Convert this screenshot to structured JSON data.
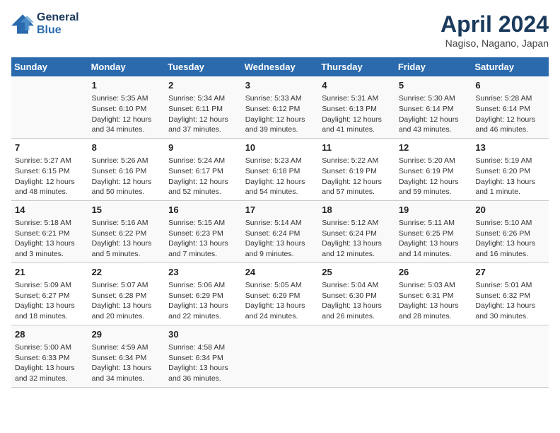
{
  "header": {
    "logo_line1": "General",
    "logo_line2": "Blue",
    "month": "April 2024",
    "location": "Nagiso, Nagano, Japan"
  },
  "days_of_week": [
    "Sunday",
    "Monday",
    "Tuesday",
    "Wednesday",
    "Thursday",
    "Friday",
    "Saturday"
  ],
  "weeks": [
    [
      {
        "day": "",
        "info": ""
      },
      {
        "day": "1",
        "info": "Sunrise: 5:35 AM\nSunset: 6:10 PM\nDaylight: 12 hours\nand 34 minutes."
      },
      {
        "day": "2",
        "info": "Sunrise: 5:34 AM\nSunset: 6:11 PM\nDaylight: 12 hours\nand 37 minutes."
      },
      {
        "day": "3",
        "info": "Sunrise: 5:33 AM\nSunset: 6:12 PM\nDaylight: 12 hours\nand 39 minutes."
      },
      {
        "day": "4",
        "info": "Sunrise: 5:31 AM\nSunset: 6:13 PM\nDaylight: 12 hours\nand 41 minutes."
      },
      {
        "day": "5",
        "info": "Sunrise: 5:30 AM\nSunset: 6:14 PM\nDaylight: 12 hours\nand 43 minutes."
      },
      {
        "day": "6",
        "info": "Sunrise: 5:28 AM\nSunset: 6:14 PM\nDaylight: 12 hours\nand 46 minutes."
      }
    ],
    [
      {
        "day": "7",
        "info": "Sunrise: 5:27 AM\nSunset: 6:15 PM\nDaylight: 12 hours\nand 48 minutes."
      },
      {
        "day": "8",
        "info": "Sunrise: 5:26 AM\nSunset: 6:16 PM\nDaylight: 12 hours\nand 50 minutes."
      },
      {
        "day": "9",
        "info": "Sunrise: 5:24 AM\nSunset: 6:17 PM\nDaylight: 12 hours\nand 52 minutes."
      },
      {
        "day": "10",
        "info": "Sunrise: 5:23 AM\nSunset: 6:18 PM\nDaylight: 12 hours\nand 54 minutes."
      },
      {
        "day": "11",
        "info": "Sunrise: 5:22 AM\nSunset: 6:19 PM\nDaylight: 12 hours\nand 57 minutes."
      },
      {
        "day": "12",
        "info": "Sunrise: 5:20 AM\nSunset: 6:19 PM\nDaylight: 12 hours\nand 59 minutes."
      },
      {
        "day": "13",
        "info": "Sunrise: 5:19 AM\nSunset: 6:20 PM\nDaylight: 13 hours\nand 1 minute."
      }
    ],
    [
      {
        "day": "14",
        "info": "Sunrise: 5:18 AM\nSunset: 6:21 PM\nDaylight: 13 hours\nand 3 minutes."
      },
      {
        "day": "15",
        "info": "Sunrise: 5:16 AM\nSunset: 6:22 PM\nDaylight: 13 hours\nand 5 minutes."
      },
      {
        "day": "16",
        "info": "Sunrise: 5:15 AM\nSunset: 6:23 PM\nDaylight: 13 hours\nand 7 minutes."
      },
      {
        "day": "17",
        "info": "Sunrise: 5:14 AM\nSunset: 6:24 PM\nDaylight: 13 hours\nand 9 minutes."
      },
      {
        "day": "18",
        "info": "Sunrise: 5:12 AM\nSunset: 6:24 PM\nDaylight: 13 hours\nand 12 minutes."
      },
      {
        "day": "19",
        "info": "Sunrise: 5:11 AM\nSunset: 6:25 PM\nDaylight: 13 hours\nand 14 minutes."
      },
      {
        "day": "20",
        "info": "Sunrise: 5:10 AM\nSunset: 6:26 PM\nDaylight: 13 hours\nand 16 minutes."
      }
    ],
    [
      {
        "day": "21",
        "info": "Sunrise: 5:09 AM\nSunset: 6:27 PM\nDaylight: 13 hours\nand 18 minutes."
      },
      {
        "day": "22",
        "info": "Sunrise: 5:07 AM\nSunset: 6:28 PM\nDaylight: 13 hours\nand 20 minutes."
      },
      {
        "day": "23",
        "info": "Sunrise: 5:06 AM\nSunset: 6:29 PM\nDaylight: 13 hours\nand 22 minutes."
      },
      {
        "day": "24",
        "info": "Sunrise: 5:05 AM\nSunset: 6:29 PM\nDaylight: 13 hours\nand 24 minutes."
      },
      {
        "day": "25",
        "info": "Sunrise: 5:04 AM\nSunset: 6:30 PM\nDaylight: 13 hours\nand 26 minutes."
      },
      {
        "day": "26",
        "info": "Sunrise: 5:03 AM\nSunset: 6:31 PM\nDaylight: 13 hours\nand 28 minutes."
      },
      {
        "day": "27",
        "info": "Sunrise: 5:01 AM\nSunset: 6:32 PM\nDaylight: 13 hours\nand 30 minutes."
      }
    ],
    [
      {
        "day": "28",
        "info": "Sunrise: 5:00 AM\nSunset: 6:33 PM\nDaylight: 13 hours\nand 32 minutes."
      },
      {
        "day": "29",
        "info": "Sunrise: 4:59 AM\nSunset: 6:34 PM\nDaylight: 13 hours\nand 34 minutes."
      },
      {
        "day": "30",
        "info": "Sunrise: 4:58 AM\nSunset: 6:34 PM\nDaylight: 13 hours\nand 36 minutes."
      },
      {
        "day": "",
        "info": ""
      },
      {
        "day": "",
        "info": ""
      },
      {
        "day": "",
        "info": ""
      },
      {
        "day": "",
        "info": ""
      }
    ]
  ]
}
